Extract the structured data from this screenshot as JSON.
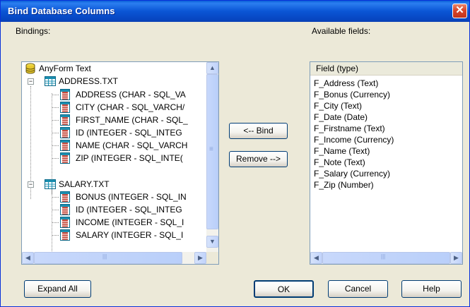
{
  "window": {
    "title": "Bind Database Columns",
    "close_glyph": "✕"
  },
  "labels": {
    "bindings": "Bindings:",
    "available_fields": "Available fields:"
  },
  "tree": {
    "root": "AnyForm Text",
    "tables": [
      {
        "name": "ADDRESS.TXT",
        "expander": "−",
        "columns": [
          "ADDRESS (CHAR - SQL_VA",
          "CITY (CHAR - SQL_VARCH/",
          "FIRST_NAME (CHAR - SQL_",
          "ID (INTEGER - SQL_INTEG",
          "NAME (CHAR - SQL_VARCH",
          "ZIP (INTEGER - SQL_INTE("
        ]
      },
      {
        "name": "SALARY.TXT",
        "expander": "−",
        "columns": [
          "BONUS (INTEGER - SQL_IN",
          "ID (INTEGER - SQL_INTEG",
          "INCOME (INTEGER - SQL_I",
          "SALARY (INTEGER - SQL_I"
        ]
      }
    ]
  },
  "fields": {
    "header": "Field (type)",
    "items": [
      "F_Address (Text)",
      "F_Bonus (Currency)",
      "F_City (Text)",
      "F_Date (Date)",
      "F_Firstname (Text)",
      "F_Income (Currency)",
      "F_Name (Text)",
      "F_Note (Text)",
      "F_Salary (Currency)",
      "F_Zip (Number)"
    ]
  },
  "buttons": {
    "bind": "<-- Bind",
    "remove": "Remove -->",
    "expand_all": "Expand All",
    "ok": "OK",
    "cancel": "Cancel",
    "help": "Help"
  },
  "scroll_glyphs": {
    "up": "▲",
    "down": "▼",
    "left": "◀",
    "right": "▶",
    "grip": "≡",
    "grip_h": "|||"
  },
  "colors": {
    "title_bar": "#0a55d5",
    "dialog_bg": "#ece9d8",
    "close": "#d9452a",
    "list_border": "#7f9db9"
  }
}
